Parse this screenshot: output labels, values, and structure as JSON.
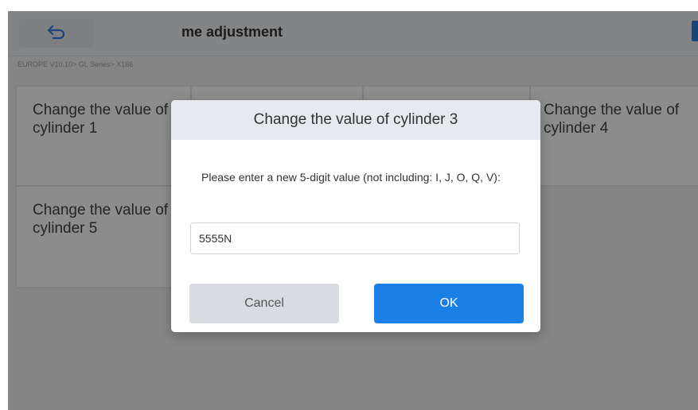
{
  "header": {
    "title": "me adjustment",
    "back_icon": "back-arrow-icon",
    "corner_icon": "menu-icon"
  },
  "breadcrumb": "EUROPE V10.10> GL Series> X166",
  "tiles": [
    {
      "label": "Change the value of cylinder 1"
    },
    {
      "label": "Change the value of cylinder 4"
    },
    {
      "label": "Change the value of cylinder 5"
    }
  ],
  "dialog": {
    "title": "Change the value of cylinder 3",
    "message": "Please enter a new 5-digit value (not including: I, J, O, Q, V):",
    "input_value": "5555N",
    "cancel_label": "Cancel",
    "ok_label": "OK"
  },
  "colors": {
    "accent": "#1a7fe6",
    "overlay": "rgba(0,0,0,0.45)"
  }
}
